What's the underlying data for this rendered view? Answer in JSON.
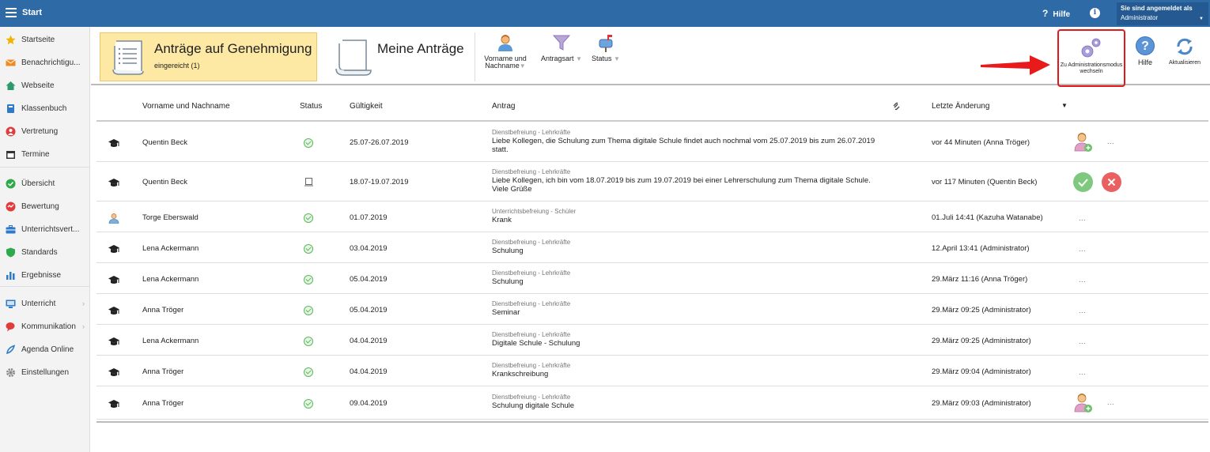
{
  "topbar": {
    "title": "Start",
    "help_label": "Hilfe",
    "login_line1": "Sie sind angemeldet als",
    "login_user": "Administrator"
  },
  "sidebar": {
    "items": [
      {
        "label": "Startseite",
        "icon": "star-icon",
        "color": "#f0b400"
      },
      {
        "label": "Benachrichtigu...",
        "icon": "envelope-icon",
        "color": "#f08a24"
      },
      {
        "label": "Webseite",
        "icon": "home-icon",
        "color": "#2e9a6a"
      },
      {
        "label": "Klassenbuch",
        "icon": "book-icon",
        "color": "#2e7ac8"
      },
      {
        "label": "Vertretung",
        "icon": "person-swap-icon",
        "color": "#e03c3c"
      },
      {
        "label": "Termine",
        "icon": "calendar-icon",
        "color": "#333333"
      },
      {
        "label": "Übersicht",
        "icon": "check-circle-icon",
        "color": "#2eaa4a"
      },
      {
        "label": "Bewertung",
        "icon": "rating-icon",
        "color": "#e03c3c"
      },
      {
        "label": "Unterrichtsvert...",
        "icon": "briefcase-icon",
        "color": "#2e7ac8"
      },
      {
        "label": "Standards",
        "icon": "shield-icon",
        "color": "#2eaa4a"
      },
      {
        "label": "Ergebnisse",
        "icon": "bar-chart-icon",
        "color": "#2e7ac8"
      },
      {
        "label": "Unterricht",
        "icon": "classroom-icon",
        "color": "#2e7ac8"
      },
      {
        "label": "Kommunikation",
        "icon": "chat-icon",
        "color": "#e03c3c"
      },
      {
        "label": "Agenda Online",
        "icon": "pen-icon",
        "color": "#2e7ac8"
      },
      {
        "label": "Einstellungen",
        "icon": "gear-icon",
        "color": "#888888"
      }
    ]
  },
  "toolbar": {
    "tile_active_title": "Anträge auf Genehmigung",
    "tile_active_sub": "eingereicht (1)",
    "tile2_title": "Meine Anträge",
    "filters": [
      "Vorname und Nachname",
      "Antragsart",
      "Status"
    ],
    "admin_label": "Zu Administrationsmodus wechseln",
    "hilfe_label": "Hilfe",
    "aktualisieren_label": "Aktualisieren"
  },
  "table": {
    "headers": [
      "Vorname und Nachname",
      "Status",
      "Gültigkeit",
      "Antrag",
      "Letzte Änderung"
    ],
    "rows": [
      {
        "name": "Quentin Beck",
        "type": "teacher",
        "status": "ok",
        "valid": "25.07-26.07.2019",
        "cat": "Dienstbefreiung - Lehrkräfte",
        "text1": "Liebe Kollegen, die Schulung zum Thema digitale Schule findet auch nochmal vom 25.07.2019 bis zum 26.07.2019",
        "text2": "statt.",
        "change": "vor 44 Minuten (Anna Tröger)",
        "actions": "person-add"
      },
      {
        "name": "Quentin Beck",
        "type": "teacher",
        "status": "pending",
        "valid": "18.07-19.07.2019",
        "cat": "Dienstbefreiung - Lehrkräfte",
        "text1": "Liebe Kollegen, ich bin vom 18.07.2019 bis zum 19.07.2019 bei einer Lehrerschulung zum Thema digitale Schule.",
        "text2": "Viele Grüße",
        "change": "vor 117 Minuten (Quentin Beck)",
        "actions": "approve"
      },
      {
        "name": "Torge Eberswald",
        "type": "student",
        "status": "ok",
        "valid": "01.07.2019",
        "cat": "Unterrichtsbefreiung - Schüler",
        "text1": "Krank",
        "text2": "",
        "change": "01.Juli 14:41 (Kazuha Watanabe)",
        "actions": "dots"
      },
      {
        "name": "Lena Ackermann",
        "type": "teacher",
        "status": "ok",
        "valid": "03.04.2019",
        "cat": "Dienstbefreiung - Lehrkräfte",
        "text1": "Schulung",
        "text2": "",
        "change": "12.April 13:41 (Administrator)",
        "actions": "dots"
      },
      {
        "name": "Lena Ackermann",
        "type": "teacher",
        "status": "ok",
        "valid": "05.04.2019",
        "cat": "Dienstbefreiung - Lehrkräfte",
        "text1": "Schulung",
        "text2": "",
        "change": "29.März 11:16 (Anna Tröger)",
        "actions": "dots"
      },
      {
        "name": "Anna Tröger",
        "type": "teacher",
        "status": "ok",
        "valid": "05.04.2019",
        "cat": "Dienstbefreiung - Lehrkräfte",
        "text1": "Seminar",
        "text2": "",
        "change": "29.März 09:25 (Administrator)",
        "actions": "dots"
      },
      {
        "name": "Lena Ackermann",
        "type": "teacher",
        "status": "ok",
        "valid": "04.04.2019",
        "cat": "Dienstbefreiung - Lehrkräfte",
        "text1": "Digitale Schule - Schulung",
        "text2": "",
        "change": "29.März 09:25 (Administrator)",
        "actions": "dots"
      },
      {
        "name": "Anna Tröger",
        "type": "teacher",
        "status": "ok",
        "valid": "04.04.2019",
        "cat": "Dienstbefreiung - Lehrkräfte",
        "text1": "Krankschreibung",
        "text2": "",
        "change": "29.März 09:04 (Administrator)",
        "actions": "dots"
      },
      {
        "name": "Anna Tröger",
        "type": "teacher",
        "status": "ok",
        "valid": "09.04.2019",
        "cat": "Dienstbefreiung - Lehrkräfte",
        "text1": "Schulung digitale Schule",
        "text2": "",
        "change": "29.März 09:03 (Administrator)",
        "actions": "person-add"
      }
    ]
  }
}
